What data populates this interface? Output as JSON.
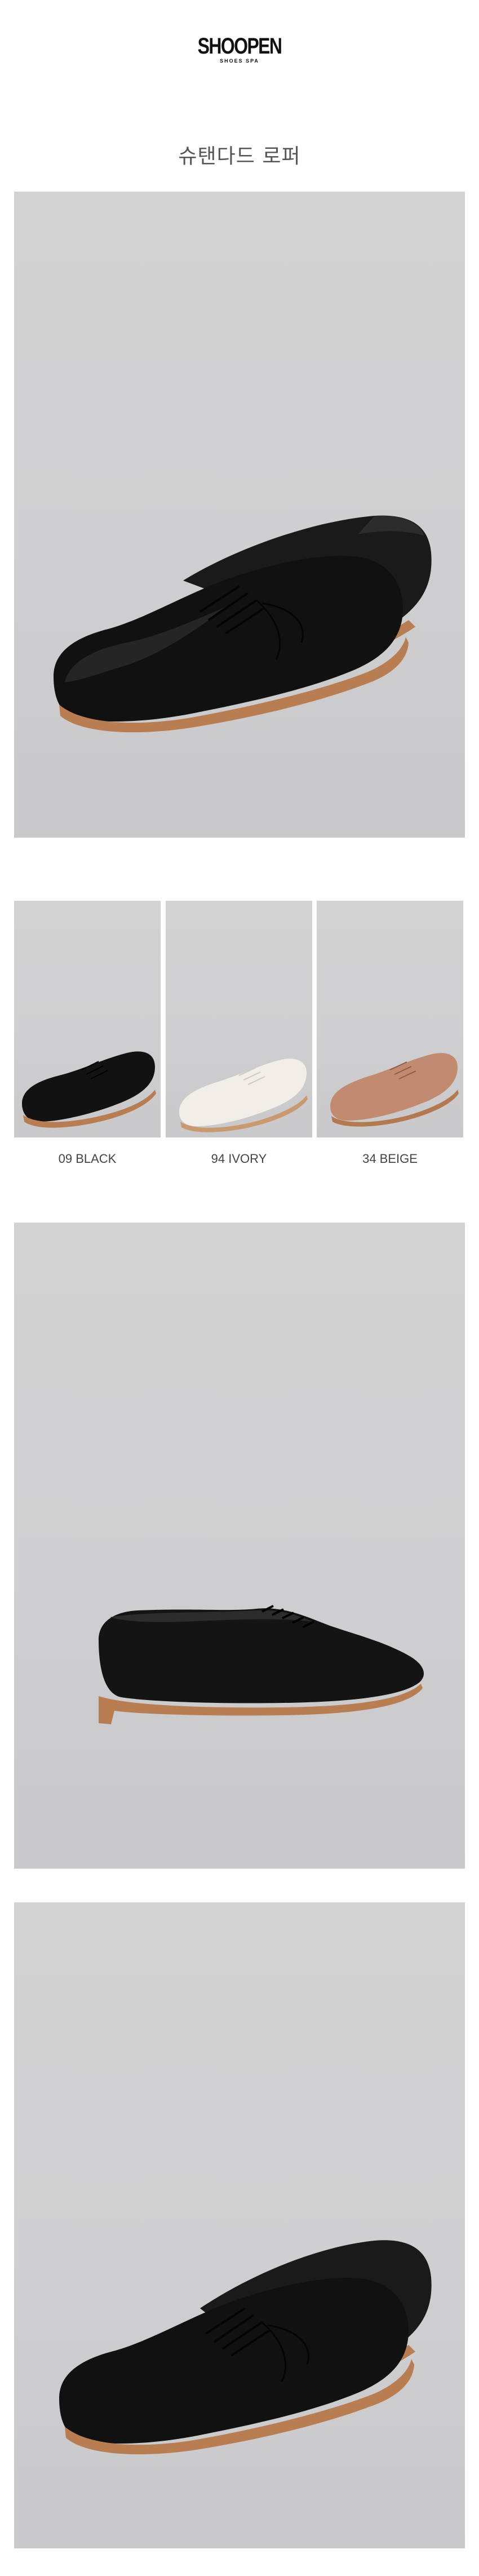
{
  "brand": {
    "name": "SHOOPEN",
    "tagline": "SHOES SPA"
  },
  "product": {
    "title": "슈탠다드 로퍼"
  },
  "colors": {
    "background": "#ffffff",
    "photo_backdrop": "#d0d0d2",
    "black_leather": "#141414",
    "ivory_leather": "#efece6",
    "beige_suede": "#c08a6f",
    "sole_tan": "#c2865b"
  },
  "variants": [
    {
      "label": "09 BLACK",
      "color": "#141414"
    },
    {
      "label": "94 IVORY",
      "color": "#efece6"
    },
    {
      "label": "34 BEIGE",
      "color": "#c08a6f"
    }
  ]
}
